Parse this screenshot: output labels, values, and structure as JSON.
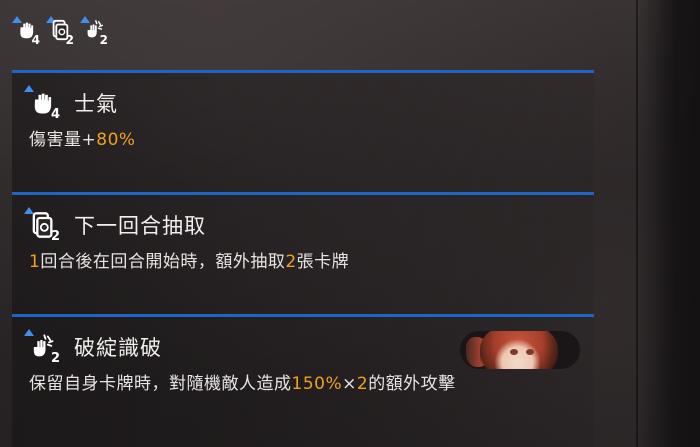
{
  "top_row": {
    "icons": [
      {
        "icon": "fist-icon",
        "count": "4"
      },
      {
        "icon": "card-draw-icon",
        "count": "2"
      },
      {
        "icon": "shatter-hand-icon",
        "count": "2"
      }
    ]
  },
  "colors": {
    "accent_line": "#1f64c6",
    "level_triangle": "#3f8ef0",
    "highlight": "#f0a21e",
    "text": "#e8e4e3"
  },
  "buffs": [
    {
      "icon": "fist-icon",
      "count": "4",
      "title": "士氣",
      "desc": {
        "pre": "傷害量+",
        "v1": "80%",
        "mid": "",
        "v2": "",
        "post": ""
      }
    },
    {
      "icon": "card-draw-icon",
      "count": "2",
      "title": "下一回合抽取",
      "desc": {
        "pre": "",
        "v1": "1",
        "mid": "回合後在回合開始時，額外抽取",
        "v2": "2",
        "post": "張卡牌"
      }
    },
    {
      "icon": "shatter-hand-icon",
      "count": "2",
      "title": "破綻識破",
      "desc": {
        "pre": "保留自身卡牌時，對隨機敵人造成",
        "v1": "150%",
        "mid": "×",
        "v2": "2",
        "post": "的額外攻擊"
      }
    }
  ]
}
